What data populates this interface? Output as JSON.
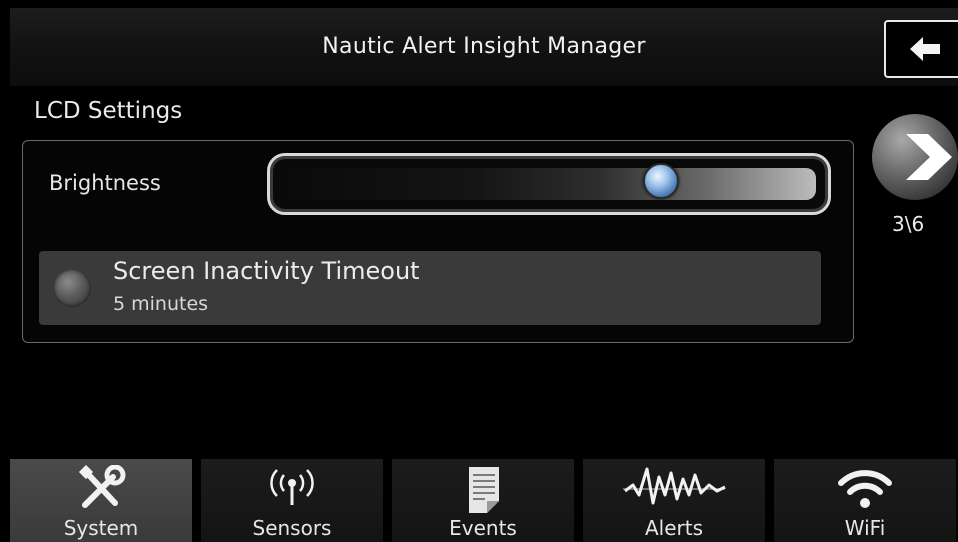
{
  "header": {
    "title": "Nautic Alert Insight Manager",
    "back_icon": "arrow-left-icon"
  },
  "section": {
    "title": "LCD Settings"
  },
  "brightness": {
    "label": "Brightness",
    "value_fraction": 0.71,
    "knob_color": "#4a7fb8"
  },
  "timeout": {
    "icon": "round-led-icon",
    "title": "Screen Inactivity Timeout",
    "value": "5 minutes"
  },
  "pagination": {
    "next_icon": "chevron-right-icon",
    "indicator": "3\\6"
  },
  "nav": {
    "active": "System",
    "tabs": [
      {
        "label": "System",
        "icon": "wrench-screwdriver-icon"
      },
      {
        "label": "Sensors",
        "icon": "antenna-icon"
      },
      {
        "label": "Events",
        "icon": "document-icon"
      },
      {
        "label": "Alerts",
        "icon": "waveform-icon"
      },
      {
        "label": "WiFi",
        "icon": "wifi-icon"
      }
    ]
  },
  "colors": {
    "background": "#000000",
    "header": "#151515",
    "active_tab": "#444444",
    "row": "#3a3a3a",
    "text": "#e8e8e8"
  }
}
